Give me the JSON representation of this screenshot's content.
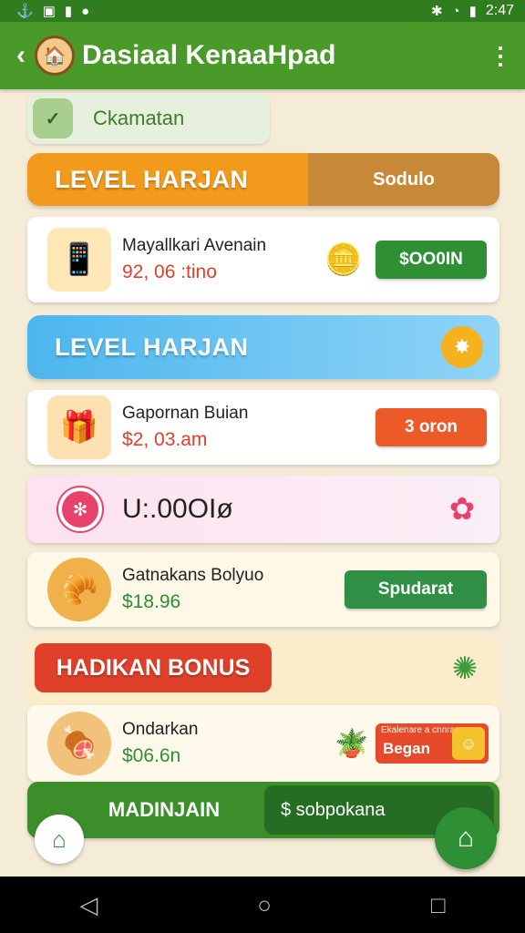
{
  "status_bar": {
    "time": "2:47",
    "left_icons": [
      "anchor-icon",
      "photo-icon",
      "bookmark-icon",
      "circle-icon"
    ],
    "right_icons": [
      "bluetooth-icon",
      "wifi-icon",
      "signal-icon"
    ]
  },
  "app_bar": {
    "title": "Dasiaal KenaaHpad"
  },
  "chip": {
    "label": "Ckamatan"
  },
  "banner_level_1": {
    "label": "LEVEL HARJAN",
    "side_label": "Sodulo"
  },
  "item_1": {
    "name": "Mayallkari Avenain",
    "price": "92, 06 :tino",
    "button": "$OO0IN"
  },
  "banner_level_2": {
    "label": "LEVEL HARJAN"
  },
  "item_2": {
    "name": "Gapornan Buian",
    "price": "$2, 03.am",
    "button": "3 oron"
  },
  "discount": {
    "amount": "U:.00OIø"
  },
  "item_3": {
    "name": "Gatnakans Bolyuo",
    "price": "$18.96",
    "button": "Spudarat"
  },
  "bonus": {
    "banner": "HADIKAN BONUS"
  },
  "item_4": {
    "name": "Ondarkan",
    "price": "$06.6n",
    "promo_top": "Ekalenare a cnnra",
    "promo_main": "Began"
  },
  "bottom_nav": {
    "main_label": "MADINJAIN",
    "side_label": "$ sobpokana"
  },
  "colors": {
    "primary_green": "#4a9a2a",
    "orange": "#f29a1c",
    "blue": "#4cb6ee",
    "red": "#e0402a"
  }
}
